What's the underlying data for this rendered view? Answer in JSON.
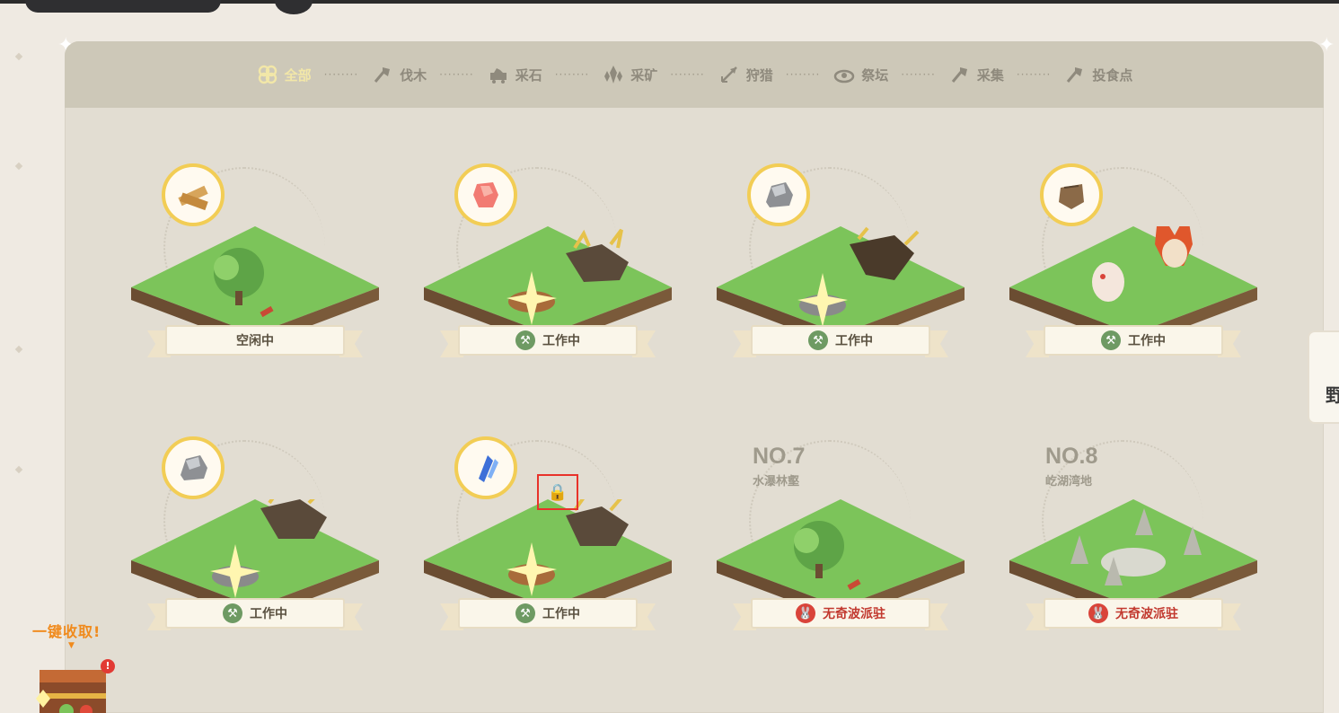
{
  "tabs": [
    {
      "id": "all",
      "label": "全部",
      "icon": "clover-icon",
      "active": true
    },
    {
      "id": "logging",
      "label": "伐木",
      "icon": "axe-icon",
      "sub": "",
      "active": false
    },
    {
      "id": "quarry",
      "label": "采石",
      "icon": "stone-cart-icon",
      "sub": "",
      "active": false
    },
    {
      "id": "mining",
      "label": "采矿",
      "icon": "ore-icon",
      "sub": "",
      "active": false
    },
    {
      "id": "hunting",
      "label": "狩猎",
      "icon": "arrow-icon",
      "sub": "",
      "active": false
    },
    {
      "id": "altar",
      "label": "祭坛",
      "icon": "altar-icon",
      "sub": "",
      "active": false
    },
    {
      "id": "gather",
      "label": "采集",
      "icon": "gather-icon",
      "sub": "",
      "active": false
    },
    {
      "id": "feed",
      "label": "投食点",
      "icon": "feed-icon",
      "sub": "",
      "active": false
    }
  ],
  "cards": [
    {
      "resource": "wood-icon",
      "status": "空闲中",
      "status_type": "idle"
    },
    {
      "resource": "pink-crystal-icon",
      "status": "工作中",
      "status_type": "working"
    },
    {
      "resource": "stone-icon",
      "status": "工作中",
      "status_type": "working"
    },
    {
      "resource": "leather-pouch-icon",
      "status": "工作中",
      "status_type": "working"
    },
    {
      "resource": "stone-icon",
      "status": "工作中",
      "status_type": "working"
    },
    {
      "resource": "blue-crystal-icon",
      "status": "工作中",
      "status_type": "working"
    },
    {
      "no": "NO.7",
      "location": "水瀑林壑",
      "status": "无奇波派驻",
      "status_type": "empty"
    },
    {
      "no": "NO.8",
      "location": "屹湖湾地",
      "status": "无奇波派驻",
      "status_type": "empty"
    }
  ],
  "collect": {
    "label": "一键收取!",
    "badge": "!"
  },
  "side_tab": {
    "label": "野"
  },
  "colors": {
    "active_tab": "#f2e7a8",
    "working_icon": "#6e9a63",
    "empty_icon": "#d9443a",
    "grass": "#7cc45a",
    "dirt": "#7a5a3a"
  }
}
